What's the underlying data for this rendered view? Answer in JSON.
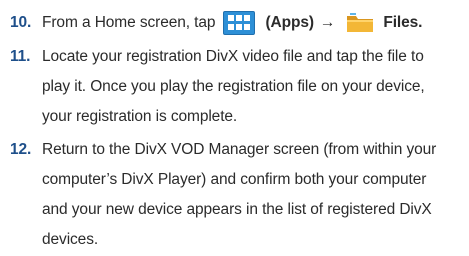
{
  "steps": [
    {
      "number": "10.",
      "pre": "From a Home screen, tap",
      "apps_label": "(Apps)",
      "arrow": "→",
      "files_label": "Files."
    },
    {
      "number": "11.",
      "lines": [
        "Locate your registration DivX video file and tap the file to",
        "play it. Once you play the registration file on your device,",
        "your registration is complete."
      ]
    },
    {
      "number": "12.",
      "lines": [
        "Return to the DivX VOD Manager screen (from within your",
        "computer’s DivX Player) and confirm both your computer",
        "and your new device appears in the list of registered DivX",
        "devices."
      ]
    }
  ],
  "icons": {
    "apps": "apps-grid-icon",
    "files": "folder-icon"
  },
  "colors": {
    "step_number": "#1e4f8a",
    "apps_icon": "#2d8fd6",
    "folder_icon": "#f3b736"
  }
}
